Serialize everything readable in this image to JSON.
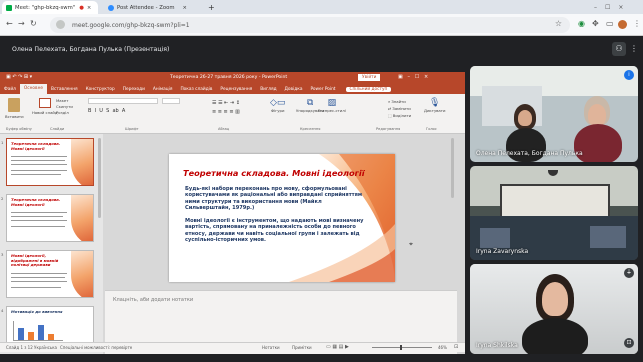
{
  "browser": {
    "tabs": [
      {
        "label": "Meet: \"ghp-bkzq-swm\"",
        "active": true
      },
      {
        "label": "Post Attendee - Zoom",
        "active": false
      }
    ],
    "new_tab": "+",
    "url": "meet.google.com/ghp-bkzq-swm?pli=1"
  },
  "meet": {
    "presenter_label": "Олена Пелехата, Богдана Пулька (Презентація)",
    "participants": [
      {
        "name": "Олена Пелехата, Богдана Пулька"
      },
      {
        "name": "Iryna Zavarynska"
      },
      {
        "name": "Iryna Shkilska"
      }
    ]
  },
  "ppt": {
    "window_title": "Теоретична 26-27 травня 2026 року  -  PowerPoint",
    "signin": "Увійти",
    "tabs": [
      "Файл",
      "Основне",
      "Вставлення",
      "Конструктор",
      "Переходи",
      "Анімація",
      "Показ слайдів",
      "Рецензування",
      "Вигляд",
      "Довідка",
      "Power Point"
    ],
    "active_tab": "Основне",
    "share": "Спільний доступ",
    "ribbon": {
      "paste": "Вставити",
      "new_slide": "Новий слайд",
      "layout": "Макет",
      "reset": "Скинути",
      "section": "Розділ",
      "draw": "Фігури",
      "arrange": "Упорядкувати",
      "quick_styles": "Експрес-стилі",
      "find": "Знайти",
      "replace": "Замінити",
      "select": "Виділити",
      "dictate": "Диктувати",
      "groups": [
        "Буфер обміну",
        "Слайди",
        "Шрифт",
        "Абзац",
        "Креслення",
        "Редагування",
        "Голос"
      ]
    },
    "thumbnails": [
      {
        "num": "1",
        "title": "Теоретична складова. Мовні ідеології"
      },
      {
        "num": "2",
        "title": "Теоретична складова. Мовні ідеології"
      },
      {
        "num": "3",
        "title": "Мовні ідеології, відображені в мовній політиці держави"
      },
      {
        "num": "4",
        "title": "Мотивація до вивчення"
      }
    ],
    "slide": {
      "title": "Теоретична складова. Мовні ідеології",
      "paragraph1": "Будь-які набори переконань про мову, сформульовані користувачами як раціональні або виправдані сприйняттям ними структури та використання мови (Майкл Сильверштайн, 1979р.)",
      "paragraph2": "Мовні ідеології є інструментом, що надають мові визначену вартість, спрямовану на приналежність особи до певного етносу, держави чи навіть соціальної групи і залежать від суспільно-історичних умов."
    },
    "notes_placeholder": "Клацніть, аби додати нотатки",
    "status": {
      "slide_count": "Слайд 1 з 12",
      "language": "Українська",
      "accessibility": "Спеціальні можливості: перевірте",
      "notes": "Нотатки",
      "comments": "Примітки",
      "zoom": "46%"
    }
  },
  "colors": {
    "ppt_accent": "#b7472a",
    "meet_bg": "#202124",
    "slide_title": "#c00000",
    "slide_text": "#1f3864"
  }
}
